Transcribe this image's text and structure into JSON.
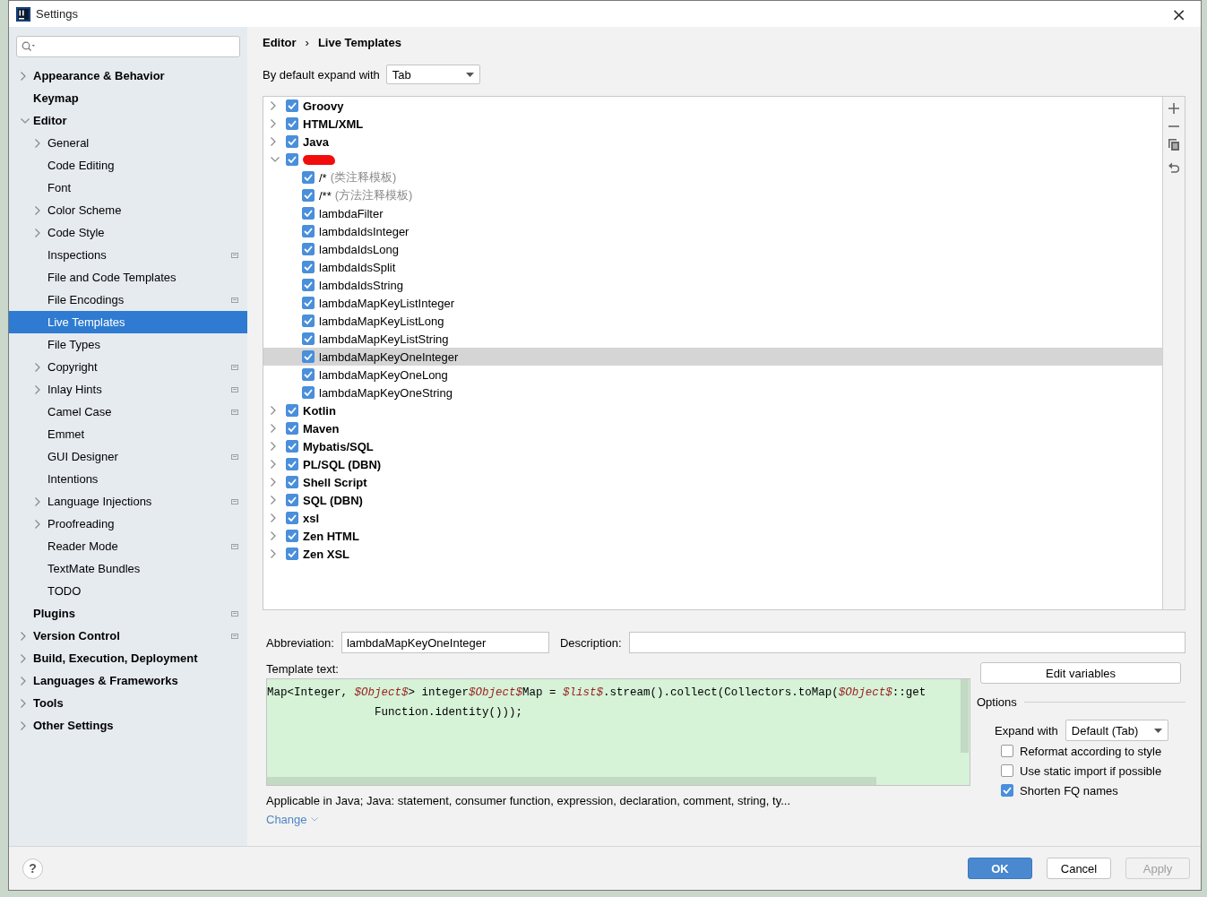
{
  "window": {
    "title": "Settings",
    "close": "×"
  },
  "sidebar": {
    "items": [
      {
        "label": "Appearance & Behavior",
        "kind": "branch",
        "expanded": false,
        "scoped": false,
        "selected": false
      },
      {
        "label": "Keymap",
        "kind": "leaf",
        "scoped": false,
        "selected": false
      },
      {
        "label": "Editor",
        "kind": "branch",
        "expanded": true,
        "scoped": false,
        "selected": false,
        "children": [
          {
            "label": "General",
            "kind": "branch",
            "expanded": false,
            "scoped": false,
            "selected": false
          },
          {
            "label": "Code Editing",
            "kind": "leaf",
            "scoped": false,
            "selected": false
          },
          {
            "label": "Font",
            "kind": "leaf",
            "scoped": false,
            "selected": false
          },
          {
            "label": "Color Scheme",
            "kind": "branch",
            "expanded": false,
            "scoped": false,
            "selected": false
          },
          {
            "label": "Code Style",
            "kind": "branch",
            "expanded": false,
            "scoped": false,
            "selected": false
          },
          {
            "label": "Inspections",
            "kind": "leaf",
            "scoped": true,
            "selected": false
          },
          {
            "label": "File and Code Templates",
            "kind": "leaf",
            "scoped": false,
            "selected": false
          },
          {
            "label": "File Encodings",
            "kind": "leaf",
            "scoped": true,
            "selected": false
          },
          {
            "label": "Live Templates",
            "kind": "leaf",
            "scoped": false,
            "selected": true
          },
          {
            "label": "File Types",
            "kind": "leaf",
            "scoped": false,
            "selected": false
          },
          {
            "label": "Copyright",
            "kind": "branch",
            "expanded": false,
            "scoped": true,
            "selected": false
          },
          {
            "label": "Inlay Hints",
            "kind": "branch",
            "expanded": false,
            "scoped": true,
            "selected": false
          },
          {
            "label": "Camel Case",
            "kind": "leaf",
            "scoped": true,
            "selected": false
          },
          {
            "label": "Emmet",
            "kind": "leaf",
            "scoped": false,
            "selected": false
          },
          {
            "label": "GUI Designer",
            "kind": "leaf",
            "scoped": true,
            "selected": false
          },
          {
            "label": "Intentions",
            "kind": "leaf",
            "scoped": false,
            "selected": false
          },
          {
            "label": "Language Injections",
            "kind": "branch",
            "expanded": false,
            "scoped": true,
            "selected": false
          },
          {
            "label": "Proofreading",
            "kind": "branch",
            "expanded": false,
            "scoped": false,
            "selected": false
          },
          {
            "label": "Reader Mode",
            "kind": "leaf",
            "scoped": true,
            "selected": false
          },
          {
            "label": "TextMate Bundles",
            "kind": "leaf",
            "scoped": false,
            "selected": false
          },
          {
            "label": "TODO",
            "kind": "leaf",
            "scoped": false,
            "selected": false
          }
        ]
      },
      {
        "label": "Plugins",
        "kind": "leaf",
        "scoped": true,
        "selected": false
      },
      {
        "label": "Version Control",
        "kind": "branch",
        "expanded": false,
        "scoped": true,
        "selected": false
      },
      {
        "label": "Build, Execution, Deployment",
        "kind": "branch",
        "expanded": false,
        "scoped": false,
        "selected": false
      },
      {
        "label": "Languages & Frameworks",
        "kind": "branch",
        "expanded": false,
        "scoped": false,
        "selected": false
      },
      {
        "label": "Tools",
        "kind": "branch",
        "expanded": false,
        "scoped": false,
        "selected": false
      },
      {
        "label": "Other Settings",
        "kind": "branch",
        "expanded": false,
        "scoped": false,
        "selected": false
      }
    ]
  },
  "breadcrumb": [
    "Editor",
    "Live Templates"
  ],
  "breadcrumb_separator": "›",
  "default_expand": {
    "label": "By default expand with",
    "value": "Tab"
  },
  "templates": [
    {
      "kind": "group",
      "label": "Groovy",
      "checked": true,
      "expanded": false,
      "selected": false
    },
    {
      "kind": "group",
      "label": "HTML/XML",
      "checked": true,
      "expanded": false,
      "selected": false
    },
    {
      "kind": "group",
      "label": "Java",
      "checked": true,
      "expanded": false,
      "selected": false
    },
    {
      "kind": "redacted",
      "checked": true,
      "expanded": true,
      "selected": false,
      "children": [
        {
          "label": "/*",
          "description": "(类注释模板)",
          "checked": true,
          "selected": false
        },
        {
          "label": "/**",
          "description": "(方法注释模板)",
          "checked": true,
          "selected": false
        },
        {
          "label": "lambdaFilter",
          "checked": true,
          "selected": false
        },
        {
          "label": "lambdaIdsInteger",
          "checked": true,
          "selected": false
        },
        {
          "label": "lambdaIdsLong",
          "checked": true,
          "selected": false
        },
        {
          "label": "lambdaIdsSplit",
          "checked": true,
          "selected": false
        },
        {
          "label": "lambdaIdsString",
          "checked": true,
          "selected": false
        },
        {
          "label": "lambdaMapKeyListInteger",
          "checked": true,
          "selected": false
        },
        {
          "label": "lambdaMapKeyListLong",
          "checked": true,
          "selected": false
        },
        {
          "label": "lambdaMapKeyListString",
          "checked": true,
          "selected": false
        },
        {
          "label": "lambdaMapKeyOneInteger",
          "checked": true,
          "selected": true
        },
        {
          "label": "lambdaMapKeyOneLong",
          "checked": true,
          "selected": false
        },
        {
          "label": "lambdaMapKeyOneString",
          "checked": true,
          "selected": false
        }
      ]
    },
    {
      "kind": "group",
      "label": "Kotlin",
      "checked": true,
      "expanded": false,
      "selected": false
    },
    {
      "kind": "group",
      "label": "Maven",
      "checked": true,
      "expanded": false,
      "selected": false
    },
    {
      "kind": "group",
      "label": "Mybatis/SQL",
      "checked": true,
      "expanded": false,
      "selected": false
    },
    {
      "kind": "group",
      "label": "PL/SQL (DBN)",
      "checked": true,
      "expanded": false,
      "selected": false
    },
    {
      "kind": "group",
      "label": "Shell Script",
      "checked": true,
      "expanded": false,
      "selected": false
    },
    {
      "kind": "group",
      "label": "SQL (DBN)",
      "checked": true,
      "expanded": false,
      "selected": false
    },
    {
      "kind": "group",
      "label": "xsl",
      "checked": true,
      "expanded": false,
      "selected": false
    },
    {
      "kind": "group",
      "label": "Zen HTML",
      "checked": true,
      "expanded": false,
      "selected": false
    },
    {
      "kind": "group",
      "label": "Zen XSL",
      "checked": true,
      "expanded": false,
      "selected": false
    }
  ],
  "abbreviation": {
    "label": "Abbreviation:",
    "value": "lambdaMapKeyOneInteger"
  },
  "description": {
    "label": "Description:"
  },
  "template_text": {
    "label": "Template text:",
    "lines": [
      [
        {
          "kind": "plain",
          "text": "Map<Integer, "
        },
        {
          "kind": "variable",
          "text": "$Object$"
        },
        {
          "kind": "plain",
          "text": "> integer"
        },
        {
          "kind": "variable",
          "text": "$Object$"
        },
        {
          "kind": "plain",
          "text": "Map = "
        },
        {
          "kind": "variable",
          "text": "$list$"
        },
        {
          "kind": "plain",
          "text": ".stream().collect(Collectors.toMap("
        },
        {
          "kind": "variable",
          "text": "$Object$"
        },
        {
          "kind": "plain",
          "text": "::get"
        }
      ],
      [
        {
          "kind": "plain",
          "text": "                Function.identity()));"
        }
      ]
    ]
  },
  "edit_variables": "Edit variables",
  "options": {
    "title": "Options",
    "expand_label": "Expand with",
    "expand_value": "Default (Tab)",
    "checkboxes": [
      {
        "label": "Reformat according to style",
        "checked": false
      },
      {
        "label": "Use static import if possible",
        "checked": false
      },
      {
        "label": "Shorten FQ names",
        "checked": true
      }
    ]
  },
  "applicable": "Applicable in Java; Java: statement, consumer function, expression, declaration, comment, string, ty...",
  "change_link": "Change",
  "help": "?",
  "buttons": [
    {
      "label": "OK",
      "kind": "primary"
    },
    {
      "label": "Cancel",
      "kind": "normal"
    },
    {
      "label": "Apply",
      "kind": "disabled"
    }
  ]
}
